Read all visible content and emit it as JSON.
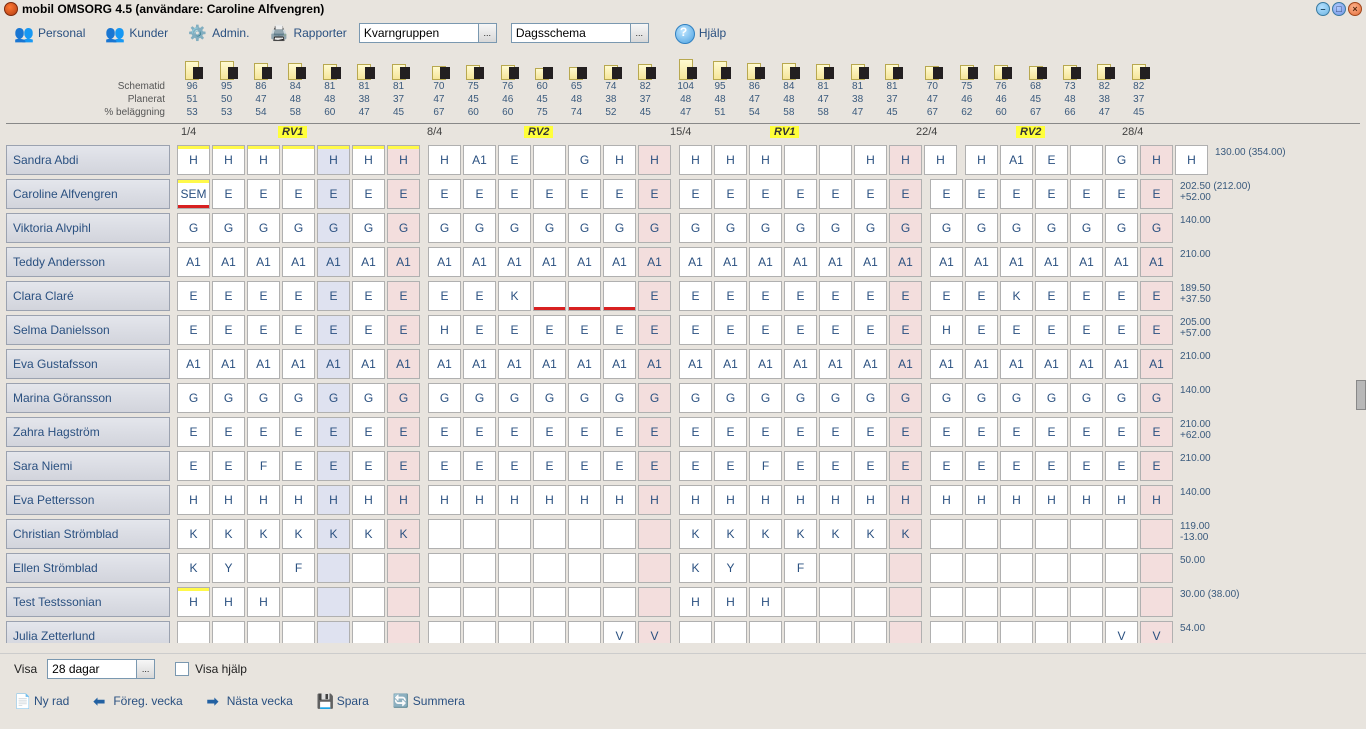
{
  "window": {
    "title": "mobil OMSORG 4.5 (användare: Caroline Alfvengren)"
  },
  "toolbar": {
    "personal": "Personal",
    "kunder": "Kunder",
    "admin": "Admin.",
    "rapporter": "Rapporter",
    "groupCombo": "Kvarngruppen",
    "scheduleCombo": "Dagsschema",
    "help": "Hjälp"
  },
  "stats": {
    "labels": {
      "schematid": "Schematid",
      "planerat": "Planerat",
      "belaggning": "% beläggning"
    },
    "cols": [
      {
        "s": "96",
        "p": "51",
        "b": "53"
      },
      {
        "s": "95",
        "p": "50",
        "b": "53"
      },
      {
        "s": "86",
        "p": "47",
        "b": "54"
      },
      {
        "s": "84",
        "p": "48",
        "b": "58"
      },
      {
        "s": "81",
        "p": "48",
        "b": "60"
      },
      {
        "s": "81",
        "p": "38",
        "b": "47"
      },
      {
        "s": "81",
        "p": "37",
        "b": "45"
      },
      {
        "s": "70",
        "p": "47",
        "b": "67"
      },
      {
        "s": "75",
        "p": "45",
        "b": "60"
      },
      {
        "s": "76",
        "p": "46",
        "b": "60"
      },
      {
        "s": "60",
        "p": "45",
        "b": "75"
      },
      {
        "s": "65",
        "p": "48",
        "b": "74"
      },
      {
        "s": "74",
        "p": "38",
        "b": "52"
      },
      {
        "s": "82",
        "p": "37",
        "b": "45"
      },
      {
        "s": "104",
        "p": "48",
        "b": "47"
      },
      {
        "s": "95",
        "p": "48",
        "b": "51"
      },
      {
        "s": "86",
        "p": "47",
        "b": "54"
      },
      {
        "s": "84",
        "p": "48",
        "b": "58"
      },
      {
        "s": "81",
        "p": "47",
        "b": "58"
      },
      {
        "s": "81",
        "p": "38",
        "b": "47"
      },
      {
        "s": "81",
        "p": "37",
        "b": "45"
      },
      {
        "s": "70",
        "p": "47",
        "b": "67"
      },
      {
        "s": "75",
        "p": "46",
        "b": "62"
      },
      {
        "s": "76",
        "p": "46",
        "b": "60"
      },
      {
        "s": "68",
        "p": "45",
        "b": "67"
      },
      {
        "s": "73",
        "p": "48",
        "b": "66"
      },
      {
        "s": "82",
        "p": "38",
        "b": "47"
      },
      {
        "s": "82",
        "p": "37",
        "b": "45"
      }
    ]
  },
  "dateHeaders": {
    "d1": "1/4",
    "d2": "8/4",
    "d3": "15/4",
    "d4": "22/4",
    "d5": "28/4",
    "rv1a": "RV1",
    "rv2a": "RV2",
    "rv1b": "RV1",
    "rv2b": "RV2"
  },
  "rows": [
    {
      "name": "Sandra Abdi",
      "summary": "130.00 (354.00)",
      "weeks": [
        [
          "H",
          "H",
          "H",
          "",
          "H",
          "H",
          "H"
        ],
        [
          "H",
          "A1",
          "E",
          "",
          "G",
          "H",
          "H"
        ],
        [
          "H",
          "H",
          "H",
          "",
          "",
          "H",
          "H",
          "H"
        ],
        [
          "H",
          "A1",
          "E",
          "",
          "G",
          "H",
          "H"
        ]
      ],
      "firstYellow": true,
      "hl": [
        4
      ],
      "pk": [
        6,
        13,
        20,
        27
      ]
    },
    {
      "name": "Caroline Alfvengren",
      "summary": "202.50 (212.00)\n+52.00",
      "weeks": [
        [
          "SEM",
          "E",
          "E",
          "E",
          "E",
          "E",
          "E"
        ],
        [
          "E",
          "E",
          "E",
          "E",
          "E",
          "E",
          "E"
        ],
        [
          "E",
          "E",
          "E",
          "E",
          "E",
          "E",
          "E"
        ],
        [
          "E",
          "E",
          "E",
          "E",
          "E",
          "E",
          "E"
        ]
      ],
      "yellowTop": [
        0
      ],
      "redU": [
        0
      ],
      "hl": [
        4
      ],
      "pk": [
        6,
        13,
        20,
        27
      ]
    },
    {
      "name": "Viktoria Alvpihl",
      "summary": "140.00",
      "weeks": [
        [
          "G",
          "G",
          "G",
          "G",
          "G",
          "G",
          "G"
        ],
        [
          "G",
          "G",
          "G",
          "G",
          "G",
          "G",
          "G"
        ],
        [
          "G",
          "G",
          "G",
          "G",
          "G",
          "G",
          "G"
        ],
        [
          "G",
          "G",
          "G",
          "G",
          "G",
          "G",
          "G"
        ]
      ],
      "hl": [
        4
      ],
      "pk": [
        6,
        13,
        20,
        27
      ]
    },
    {
      "name": "Teddy Andersson",
      "summary": "210.00",
      "weeks": [
        [
          "A1",
          "A1",
          "A1",
          "A1",
          "A1",
          "A1",
          "A1"
        ],
        [
          "A1",
          "A1",
          "A1",
          "A1",
          "A1",
          "A1",
          "A1"
        ],
        [
          "A1",
          "A1",
          "A1",
          "A1",
          "A1",
          "A1",
          "A1"
        ],
        [
          "A1",
          "A1",
          "A1",
          "A1",
          "A1",
          "A1",
          "A1"
        ]
      ],
      "hl": [
        4
      ],
      "pk": [
        6,
        13,
        20,
        27
      ]
    },
    {
      "name": "Clara Claré",
      "summary": "189.50\n+37.50",
      "weeks": [
        [
          "E",
          "E",
          "E",
          "E",
          "E",
          "E",
          "E"
        ],
        [
          "E",
          "E",
          "K",
          "",
          "",
          "",
          "E"
        ],
        [
          "E",
          "E",
          "E",
          "E",
          "E",
          "E",
          "E"
        ],
        [
          "E",
          "E",
          "K",
          "E",
          "E",
          "E",
          "E"
        ]
      ],
      "redU": [
        10,
        11,
        12
      ],
      "hl": [
        4
      ],
      "pk": [
        6,
        13,
        20,
        27
      ]
    },
    {
      "name": "Selma Danielsson",
      "summary": "205.00\n+57.00",
      "weeks": [
        [
          "E",
          "E",
          "E",
          "E",
          "E",
          "E",
          "E"
        ],
        [
          "H",
          "E",
          "E",
          "E",
          "E",
          "E",
          "E"
        ],
        [
          "E",
          "E",
          "E",
          "E",
          "E",
          "E",
          "E"
        ],
        [
          "H",
          "E",
          "E",
          "E",
          "E",
          "E",
          "E"
        ]
      ],
      "hl": [
        4
      ],
      "pk": [
        6,
        13,
        20,
        27
      ]
    },
    {
      "name": "Eva Gustafsson",
      "summary": "210.00",
      "weeks": [
        [
          "A1",
          "A1",
          "A1",
          "A1",
          "A1",
          "A1",
          "A1"
        ],
        [
          "A1",
          "A1",
          "A1",
          "A1",
          "A1",
          "A1",
          "A1"
        ],
        [
          "A1",
          "A1",
          "A1",
          "A1",
          "A1",
          "A1",
          "A1"
        ],
        [
          "A1",
          "A1",
          "A1",
          "A1",
          "A1",
          "A1",
          "A1"
        ]
      ],
      "hl": [
        4
      ],
      "pk": [
        6,
        13,
        20,
        27
      ]
    },
    {
      "name": "Marina Göransson",
      "summary": "140.00",
      "weeks": [
        [
          "G",
          "G",
          "G",
          "G",
          "G",
          "G",
          "G"
        ],
        [
          "G",
          "G",
          "G",
          "G",
          "G",
          "G",
          "G"
        ],
        [
          "G",
          "G",
          "G",
          "G",
          "G",
          "G",
          "G"
        ],
        [
          "G",
          "G",
          "G",
          "G",
          "G",
          "G",
          "G"
        ]
      ],
      "hl": [
        4
      ],
      "pk": [
        6,
        13,
        20,
        27
      ]
    },
    {
      "name": "Zahra Hagström",
      "summary": "210.00\n+62.00",
      "weeks": [
        [
          "E",
          "E",
          "E",
          "E",
          "E",
          "E",
          "E"
        ],
        [
          "E",
          "E",
          "E",
          "E",
          "E",
          "E",
          "E"
        ],
        [
          "E",
          "E",
          "E",
          "E",
          "E",
          "E",
          "E"
        ],
        [
          "E",
          "E",
          "E",
          "E",
          "E",
          "E",
          "E"
        ]
      ],
      "hl": [
        4
      ],
      "pk": [
        6,
        13,
        20,
        27
      ]
    },
    {
      "name": "Sara Niemi",
      "summary": "210.00",
      "weeks": [
        [
          "E",
          "E",
          "F",
          "E",
          "E",
          "E",
          "E"
        ],
        [
          "E",
          "E",
          "E",
          "E",
          "E",
          "E",
          "E"
        ],
        [
          "E",
          "E",
          "F",
          "E",
          "E",
          "E",
          "E"
        ],
        [
          "E",
          "E",
          "E",
          "E",
          "E",
          "E",
          "E"
        ]
      ],
      "hl": [
        4
      ],
      "pk": [
        6,
        13,
        20,
        27
      ]
    },
    {
      "name": "Eva Pettersson",
      "summary": "140.00",
      "weeks": [
        [
          "H",
          "H",
          "H",
          "H",
          "H",
          "H",
          "H"
        ],
        [
          "H",
          "H",
          "H",
          "H",
          "H",
          "H",
          "H"
        ],
        [
          "H",
          "H",
          "H",
          "H",
          "H",
          "H",
          "H"
        ],
        [
          "H",
          "H",
          "H",
          "H",
          "H",
          "H",
          "H"
        ]
      ],
      "hl": [
        4
      ],
      "pk": [
        6,
        13,
        20,
        27
      ]
    },
    {
      "name": "Christian Strömblad",
      "summary": "119.00\n-13.00",
      "weeks": [
        [
          "K",
          "K",
          "K",
          "K",
          "K",
          "K",
          "K"
        ],
        [
          "",
          "",
          "",
          "",
          "",
          "",
          ""
        ],
        [
          "K",
          "K",
          "K",
          "K",
          "K",
          "K",
          "K"
        ],
        [
          "",
          "",
          "",
          "",
          "",
          "",
          ""
        ]
      ],
      "hl": [
        4
      ],
      "pk": [
        6,
        13,
        20,
        27
      ]
    },
    {
      "name": "Ellen Strömblad",
      "summary": "50.00",
      "weeks": [
        [
          "K",
          "Y",
          "",
          "F",
          "",
          "",
          ""
        ],
        [
          "",
          "",
          "",
          "",
          "",
          "",
          ""
        ],
        [
          "K",
          "Y",
          "",
          "F",
          "",
          "",
          ""
        ],
        [
          "",
          "",
          "",
          "",
          "",
          "",
          ""
        ]
      ],
      "hl": [
        4
      ],
      "pk": [
        6,
        13,
        20,
        27
      ]
    },
    {
      "name": "Test Testssonian",
      "summary": "30.00 (38.00)",
      "weeks": [
        [
          "H",
          "H",
          "H",
          "",
          "",
          "",
          ""
        ],
        [
          "",
          "",
          "",
          "",
          "",
          "",
          ""
        ],
        [
          "H",
          "H",
          "H",
          "",
          "",
          "",
          ""
        ],
        [
          "",
          "",
          "",
          "",
          "",
          "",
          ""
        ]
      ],
      "yellowTop": [
        0
      ],
      "hl": [
        4
      ],
      "pk": [
        6,
        13,
        20,
        27
      ]
    },
    {
      "name": "Julia Zetterlund",
      "summary": "54.00",
      "weeks": [
        [
          "",
          "",
          "",
          "",
          "",
          "",
          ""
        ],
        [
          "",
          "",
          "",
          "",
          "",
          "V",
          "V"
        ],
        [
          "",
          "",
          "",
          "",
          "",
          "",
          ""
        ],
        [
          "",
          "",
          "",
          "",
          "",
          "V",
          "V"
        ]
      ],
      "hl": [
        4
      ],
      "pk": [
        6,
        13,
        20,
        27
      ]
    }
  ],
  "bottom": {
    "visa": "Visa",
    "days": "28 dagar",
    "visaHjalp": "Visa hjälp",
    "nyRad": "Ny rad",
    "foreg": "Föreg. vecka",
    "nasta": "Nästa vecka",
    "spara": "Spara",
    "summera": "Summera"
  }
}
